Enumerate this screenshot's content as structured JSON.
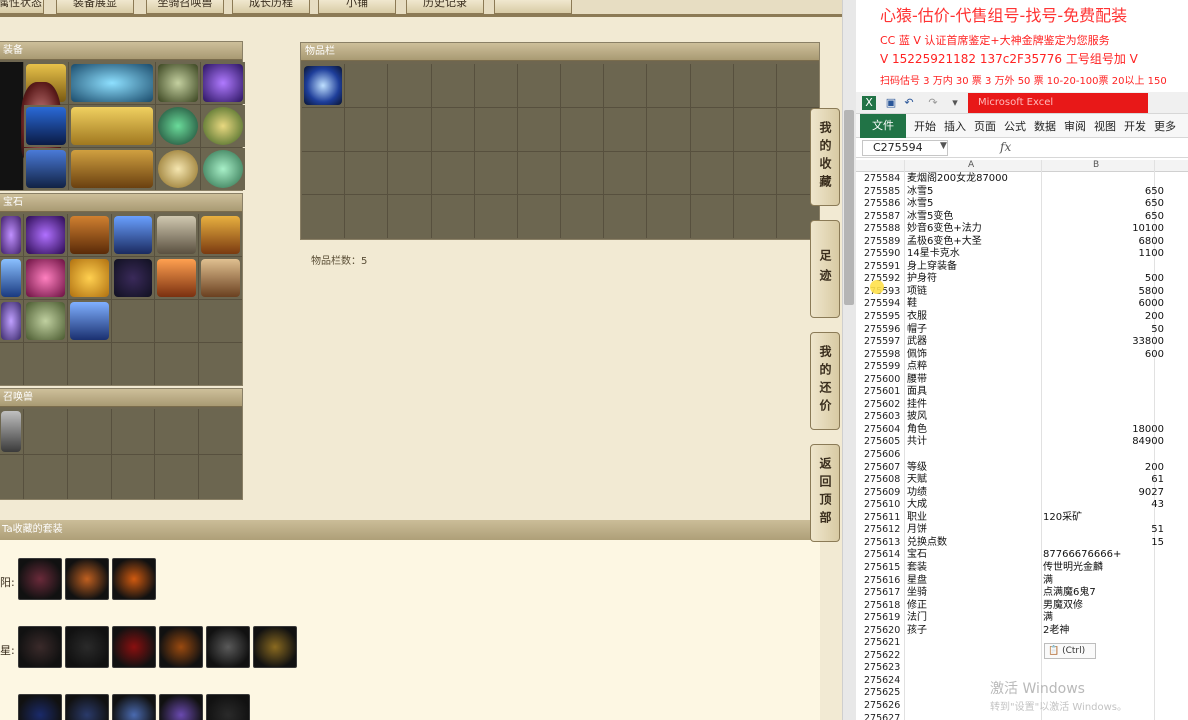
{
  "game": {
    "top_tabs": [
      "属性状态",
      "装备展显",
      "坐骑召唤兽",
      "成长历程",
      "小铺",
      "历史记录"
    ],
    "equip_title": "装备",
    "gem_title": "宝石",
    "pet_title": "召唤兽",
    "bag_title": "物品栏",
    "bag_count_label": "物品栏数：5",
    "collection_title": "Ta收藏的套装",
    "row_labels": [
      "阳:",
      "星:"
    ],
    "side_buttons": [
      {
        "label": "我的收藏"
      },
      {
        "label": "足迹"
      },
      {
        "label": "我的还价"
      },
      {
        "label": "返回顶部"
      }
    ]
  },
  "promo": {
    "title": "心猿-估价-代售组号-找号-免费配装",
    "line1": "CC 蓝 V 认证首席鉴定+大神金牌鉴定为您服务",
    "line2": "V 15225921182   137c2F35776  工号组号加 V",
    "line3": "扫码估号 3 万内 30 票  3 万外 50 票  10-20-100票 20以上 150"
  },
  "excel": {
    "window_title": "Microsoft Excel",
    "ribbon_tabs": [
      "文件",
      "开始",
      "插入",
      "页面",
      "公式",
      "数据",
      "审阅",
      "视图",
      "开发",
      "更多"
    ],
    "name_box": "C275594",
    "fx": "fx",
    "col_a": "A",
    "col_b": "B",
    "paste_label": "(Ctrl)",
    "watermark_1": "激活 Windows",
    "watermark_2": "转到\"设置\"以激活 Windows。",
    "rows": [
      {
        "n": "275584",
        "a": "麦烟阁200女龙87000",
        "b": ""
      },
      {
        "n": "275585",
        "a": "冰雪5",
        "b": "650"
      },
      {
        "n": "275586",
        "a": "冰雪5",
        "b": "650"
      },
      {
        "n": "275587",
        "a": "冰雪5变色",
        "b": "650"
      },
      {
        "n": "275588",
        "a": "妙音6变色+法力",
        "b": "10100"
      },
      {
        "n": "275589",
        "a": "孟极6变色+大圣",
        "b": "6800"
      },
      {
        "n": "275590",
        "a": "14星卡克水",
        "b": "1100"
      },
      {
        "n": "275591",
        "a": "身上穿装备",
        "b": ""
      },
      {
        "n": "275592",
        "a": "护身符",
        "b": "500"
      },
      {
        "n": "275593",
        "a": "项链",
        "b": "5800"
      },
      {
        "n": "275594",
        "a": "鞋",
        "b": "6000"
      },
      {
        "n": "275595",
        "a": "衣服",
        "b": "200"
      },
      {
        "n": "275596",
        "a": "帽子",
        "b": "50"
      },
      {
        "n": "275597",
        "a": "武器",
        "b": "33800"
      },
      {
        "n": "275598",
        "a": "佩饰",
        "b": "600"
      },
      {
        "n": "275599",
        "a": "点粹",
        "b": ""
      },
      {
        "n": "275600",
        "a": "腰带",
        "b": ""
      },
      {
        "n": "275601",
        "a": "面具",
        "b": ""
      },
      {
        "n": "275602",
        "a": "挂件",
        "b": ""
      },
      {
        "n": "275603",
        "a": "披风",
        "b": ""
      },
      {
        "n": "275604",
        "a": "角色",
        "b": "18000"
      },
      {
        "n": "275605",
        "a": "共计",
        "b": "84900"
      },
      {
        "n": "275606",
        "a": "",
        "b": ""
      },
      {
        "n": "275607",
        "a": "等级",
        "b": "200"
      },
      {
        "n": "275608",
        "a": "天赋",
        "b": "61"
      },
      {
        "n": "275609",
        "a": "功绩",
        "b": "9027"
      },
      {
        "n": "275610",
        "a": "大成",
        "b": "43"
      },
      {
        "n": "275611",
        "a": "职业",
        "b": "120采矿",
        "txt": true
      },
      {
        "n": "275612",
        "a": "月饼",
        "b": "51"
      },
      {
        "n": "275613",
        "a": "兑换点数",
        "b": "15"
      },
      {
        "n": "275614",
        "a": "宝石",
        "b": "87766676666+",
        "txt": true
      },
      {
        "n": "275615",
        "a": "套装",
        "b": "传世明光金麟",
        "txt": true
      },
      {
        "n": "275616",
        "a": "星盘",
        "b": "满",
        "txt": true
      },
      {
        "n": "275617",
        "a": "坐骑",
        "b": "点满魔6鬼7",
        "txt": true
      },
      {
        "n": "275618",
        "a": "修正",
        "b": "男魔双修",
        "txt": true
      },
      {
        "n": "275619",
        "a": "法门",
        "b": "满",
        "txt": true
      },
      {
        "n": "275620",
        "a": "孩子",
        "b": "2老神",
        "txt": true
      },
      {
        "n": "275621",
        "a": "",
        "b": ""
      },
      {
        "n": "275622",
        "a": "",
        "b": ""
      },
      {
        "n": "275623",
        "a": "",
        "b": ""
      },
      {
        "n": "275624",
        "a": "",
        "b": ""
      },
      {
        "n": "275625",
        "a": "",
        "b": ""
      },
      {
        "n": "275626",
        "a": "",
        "b": ""
      },
      {
        "n": "275627",
        "a": "",
        "b": ""
      }
    ]
  },
  "colors": {
    "promo_red": "#ff2222",
    "excel_green": "#217346",
    "title_red": "#e81818"
  }
}
